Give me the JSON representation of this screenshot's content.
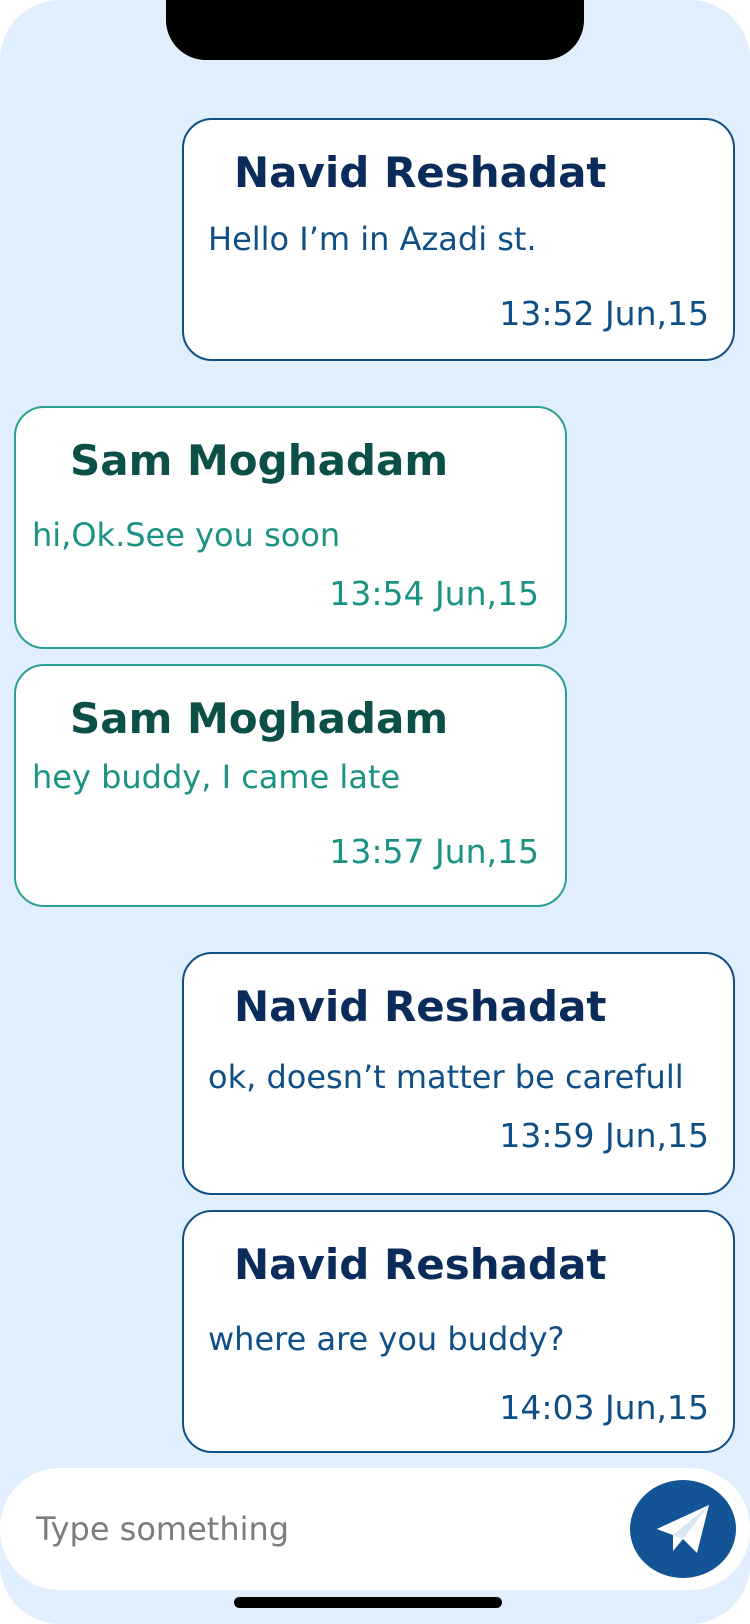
{
  "messages": [
    {
      "sender": "Navid Reshadat",
      "text": "Hello I’m in Azadi st.",
      "time": "13:52 Jun,15"
    },
    {
      "sender": "Sam Moghadam",
      "text": "hi,Ok.See you soon",
      "time": "13:54 Jun,15"
    },
    {
      "sender": "Sam Moghadam",
      "text": "hey buddy, I came late",
      "time": "13:57 Jun,15"
    },
    {
      "sender": "Navid Reshadat",
      "text": "ok, doesn’t matter be carefull",
      "time": "13:59 Jun,15"
    },
    {
      "sender": "Navid Reshadat",
      "text": "where are you buddy?",
      "time": "14:03 Jun,15"
    }
  ],
  "composer": {
    "placeholder": "Type something",
    "value": ""
  },
  "icons": {
    "send": "paper-plane-icon"
  },
  "colors": {
    "background": "#e1eefd",
    "outgoing_accent": "#0f4f86",
    "incoming_accent": "#2aa093",
    "send_button": "#125496"
  }
}
